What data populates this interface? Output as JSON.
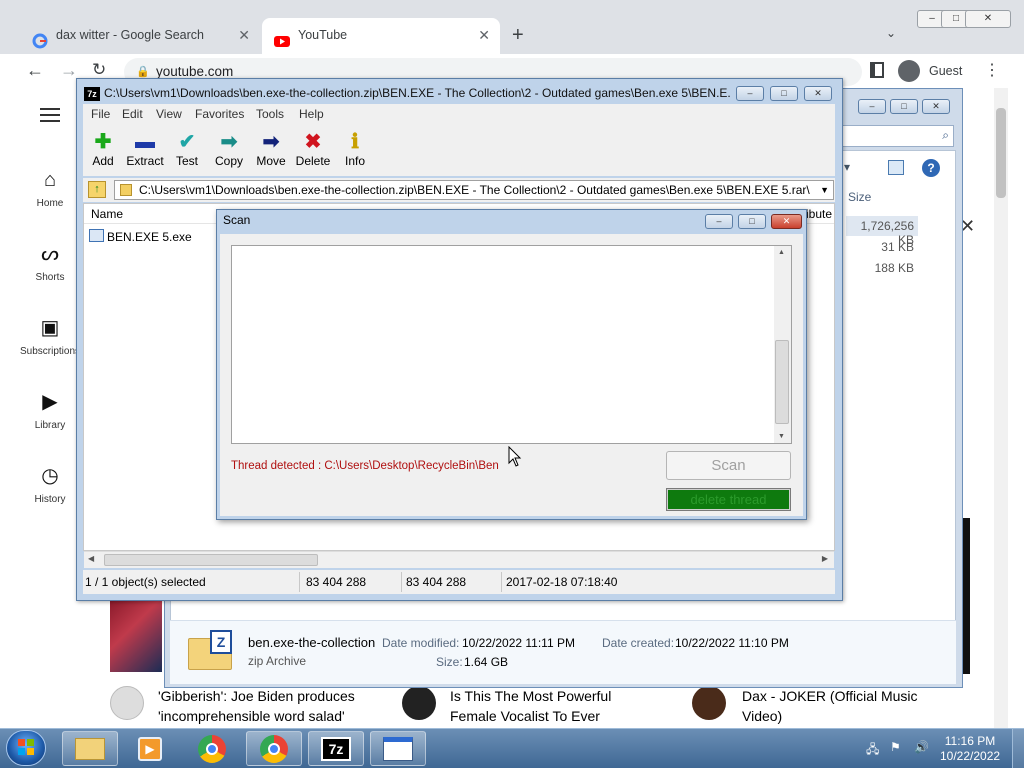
{
  "chrome": {
    "tabs": [
      {
        "title": "dax witter - Google Search"
      },
      {
        "title": "YouTube"
      }
    ],
    "new_tab": "+",
    "address": "youtube.com",
    "profile": "Guest",
    "window_controls": {
      "minimize": "–",
      "maximize": "□",
      "close": "✕"
    }
  },
  "youtube": {
    "sidebar": [
      {
        "label": "Home",
        "icon": "home-icon"
      },
      {
        "label": "Shorts",
        "icon": "shorts-icon"
      },
      {
        "label": "Subscriptions",
        "icon": "subscriptions-icon"
      },
      {
        "label": "Library",
        "icon": "library-icon"
      },
      {
        "label": "History",
        "icon": "history-icon"
      }
    ],
    "videos": [
      {
        "title_line1": "'Gibberish': Joe Biden produces",
        "title_line2": "'incomprehensible word salad'"
      },
      {
        "title_line1": "Is This The Most Powerful",
        "title_line2": "Female Vocalist To Ever"
      },
      {
        "title_line1": "Dax - JOKER (Official Music",
        "title_line2": "Video)"
      }
    ]
  },
  "explorer": {
    "size_header": "Size",
    "sizes": [
      "1,726,256 KB",
      "31 KB",
      "188 KB"
    ],
    "file": {
      "name": "ben.exe-the-collection",
      "type": "zip Archive",
      "modified_label": "Date modified:",
      "modified": "10/22/2022 11:11 PM",
      "created_label": "Date created:",
      "created": "10/22/2022 11:10 PM",
      "size_label": "Size:",
      "size": "1.64 GB"
    }
  },
  "zip": {
    "title": "C:\\Users\\vm1\\Downloads\\ben.exe-the-collection.zip\\BEN.EXE - The Collection\\2 - Outdated games\\Ben.exe 5\\BEN.E...",
    "menu": [
      "File",
      "Edit",
      "View",
      "Favorites",
      "Tools",
      "Help"
    ],
    "tools": [
      "Add",
      "Extract",
      "Test",
      "Copy",
      "Move",
      "Delete",
      "Info"
    ],
    "address": "C:\\Users\\vm1\\Downloads\\ben.exe-the-collection.zip\\BEN.EXE - The Collection\\2 - Outdated games\\Ben.exe 5\\BEN.EXE 5.rar\\",
    "columns": {
      "name": "Name",
      "attributes": "ibute"
    },
    "items": [
      {
        "name": "BEN.EXE 5.exe"
      }
    ],
    "status": {
      "selected": "1 / 1 object(s) selected",
      "size": "83 404 288",
      "packed": "83 404 288",
      "modified": "2017-02-18 07:18:40"
    }
  },
  "scan": {
    "title": "Scan",
    "message": "Thread detected : C:\\Users\\Desktop\\RecycleBin\\Ben",
    "scan_button": "Scan",
    "delete_button": "delete thread"
  },
  "taskbar": {
    "time": "11:16 PM",
    "date": "10/22/2022"
  }
}
